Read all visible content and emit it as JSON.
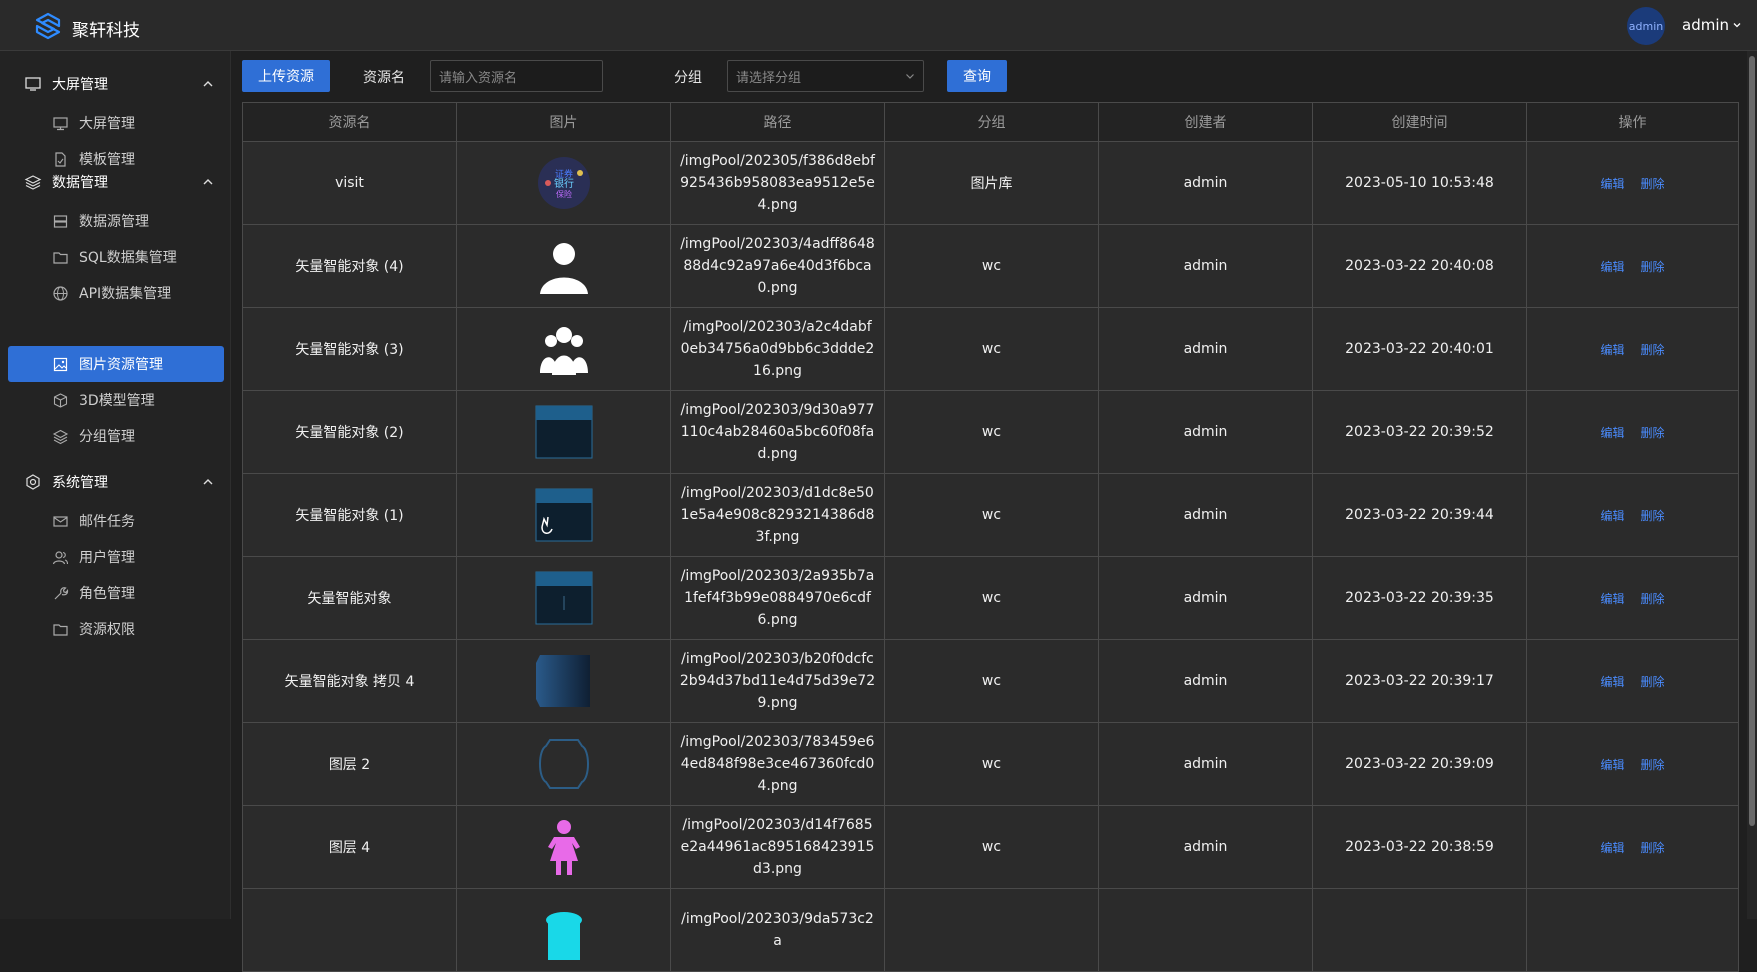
{
  "header": {
    "brand": "聚轩科技",
    "avatar_text": "admin",
    "username": "admin"
  },
  "sidebar": {
    "sections": [
      {
        "label": "大屏管理",
        "items": [
          {
            "label": "大屏管理"
          },
          {
            "label": "模板管理"
          }
        ]
      },
      {
        "label": "数据管理",
        "items": [
          {
            "label": "数据源管理"
          },
          {
            "label": "SQL数据集管理"
          },
          {
            "label": "API数据集管理"
          },
          {
            "label": "图片资源管理",
            "active": true
          },
          {
            "label": "3D模型管理"
          },
          {
            "label": "分组管理"
          }
        ]
      },
      {
        "label": "系统管理",
        "items": [
          {
            "label": "邮件任务"
          },
          {
            "label": "用户管理"
          },
          {
            "label": "角色管理"
          },
          {
            "label": "资源权限"
          }
        ]
      }
    ]
  },
  "toolbar": {
    "upload_label": "上传资源",
    "name_label": "资源名",
    "name_placeholder": "请输入资源名",
    "group_label": "分组",
    "group_placeholder": "请选择分组",
    "query_label": "查询"
  },
  "table": {
    "headers": [
      "资源名",
      "图片",
      "路径",
      "分组",
      "创建者",
      "创建时间",
      "操作"
    ],
    "edit_label": "编辑",
    "delete_label": "删除",
    "rows": [
      {
        "name": "visit",
        "path": "/imgPool/202305/f386d8ebf925436b958083ea9512e5e4.png",
        "group": "图片库",
        "creator": "admin",
        "time": "2023-05-10 10:53:48",
        "thumb": "wordcloud"
      },
      {
        "name": "矢量智能对象 (4)",
        "path": "/imgPool/202303/4adff864888d4c92a97a6e40d3f6bca0.png",
        "group": "wc",
        "creator": "admin",
        "time": "2023-03-22 20:40:08",
        "thumb": "person"
      },
      {
        "name": "矢量智能对象 (3)",
        "path": "/imgPool/202303/a2c4dabf0eb34756a0d9bb6c3ddde216.png",
        "group": "wc",
        "creator": "admin",
        "time": "2023-03-22 20:40:01",
        "thumb": "group"
      },
      {
        "name": "矢量智能对象 (2)",
        "path": "/imgPool/202303/9d30a977110c4ab28460a5bc60f08fad.png",
        "group": "wc",
        "creator": "admin",
        "time": "2023-03-22 20:39:52",
        "thumb": "panel"
      },
      {
        "name": "矢量智能对象 (1)",
        "path": "/imgPool/202303/d1dc8e501e5a4e908c8293214386d83f.png",
        "group": "wc",
        "creator": "admin",
        "time": "2023-03-22 20:39:44",
        "thumb": "panel-hand"
      },
      {
        "name": "矢量智能对象",
        "path": "/imgPool/202303/2a935b7a1fef4f3b99e0884970e6cdf6.png",
        "group": "wc",
        "creator": "admin",
        "time": "2023-03-22 20:39:35",
        "thumb": "panel-line"
      },
      {
        "name": "矢量智能对象 拷贝 4",
        "path": "/imgPool/202303/b20f0dcfc2b94d37bd11e4d75d39e729.png",
        "group": "wc",
        "creator": "admin",
        "time": "2023-03-22 20:39:17",
        "thumb": "gradient"
      },
      {
        "name": "图层 2",
        "path": "/imgPool/202303/783459e64ed848f98e3ce467360fcd04.png",
        "group": "wc",
        "creator": "admin",
        "time": "2023-03-22 20:39:09",
        "thumb": "ring"
      },
      {
        "name": "图层 4",
        "path": "/imgPool/202303/d14f7685e2a44961ac895168423915d3.png",
        "group": "wc",
        "creator": "admin",
        "time": "2023-03-22 20:38:59",
        "thumb": "woman"
      },
      {
        "name": "",
        "path": "/imgPool/202303/9da573c2a",
        "group": "",
        "creator": "",
        "time": "",
        "thumb": "cyan"
      }
    ]
  },
  "colors": {
    "accent": "#2f6fd6",
    "link": "#4a8cff",
    "woman_icon": "#e86ae8",
    "panel_blue": "#1e5f8c"
  }
}
